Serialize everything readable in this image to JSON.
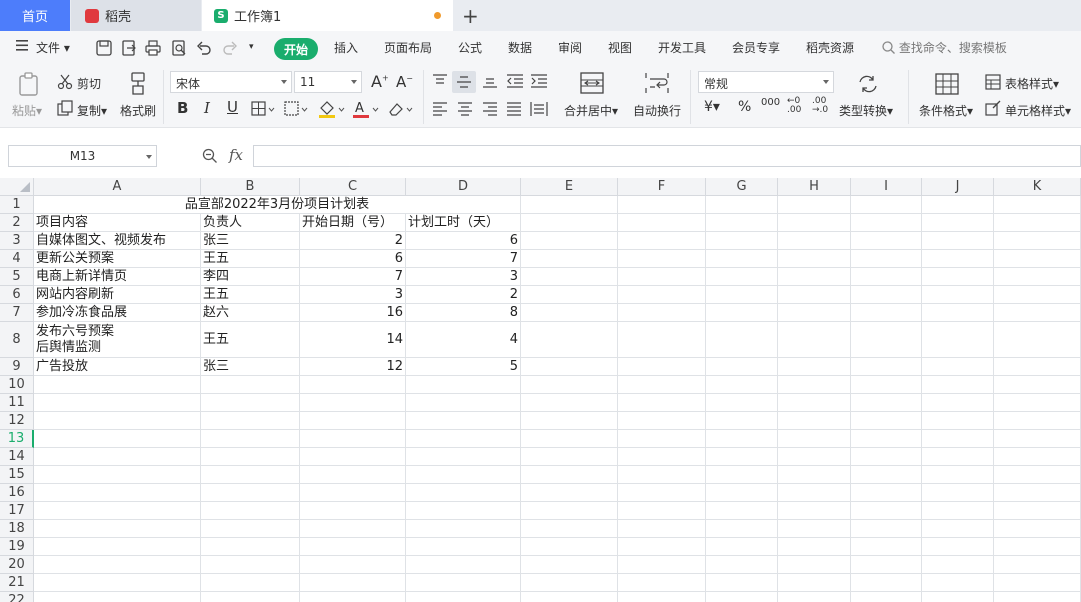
{
  "tabs": {
    "home": "首页",
    "daoke": "稻壳",
    "workbook": "工作簿1"
  },
  "menu": {
    "file": "文件",
    "items": [
      "开始",
      "插入",
      "页面布局",
      "公式",
      "数据",
      "审阅",
      "视图",
      "开发工具",
      "会员专享",
      "稻壳资源"
    ],
    "search_placeholder": "查找命令、搜索模板"
  },
  "ribbon": {
    "paste": "粘贴",
    "cut": "剪切",
    "copy": "复制",
    "format_painter": "格式刷",
    "font_name": "宋体",
    "font_size": "11",
    "merge_center": "合并居中",
    "wrap_text": "自动换行",
    "number_format": "常规",
    "type_convert": "类型转换",
    "cond_format": "条件格式",
    "table_style": "表格样式",
    "cell_style": "单元格样式"
  },
  "formula_bar": {
    "name_box": "M13",
    "fx": "fx",
    "content": ""
  },
  "sheet": {
    "columns": [
      "A",
      "B",
      "C",
      "D",
      "E",
      "F",
      "G",
      "H",
      "I",
      "J",
      "K"
    ],
    "rows": [
      "1",
      "2",
      "3",
      "4",
      "5",
      "6",
      "7",
      "8",
      "9",
      "10",
      "11",
      "12",
      "13",
      "14",
      "15",
      "16",
      "17",
      "18",
      "19",
      "20",
      "21",
      "22"
    ],
    "title": "品宣部2022年3月份项目计划表",
    "headers": [
      "项目内容",
      "负责人",
      "开始日期（号）",
      "计划工时（天）"
    ],
    "data": [
      [
        "自媒体图文、视频发布",
        "张三",
        "2",
        "6"
      ],
      [
        "更新公关预案",
        "王五",
        "6",
        "7"
      ],
      [
        "电商上新详情页",
        "李四",
        "7",
        "3"
      ],
      [
        "网站内容刷新",
        "王五",
        "3",
        "2"
      ],
      [
        "参加冷冻食品展",
        "赵六",
        "16",
        "8"
      ],
      [
        "发布六号预案\n后舆情监测",
        "王五",
        "14",
        "4"
      ],
      [
        "广告投放",
        "张三",
        "12",
        "5"
      ]
    ],
    "active_row": "13"
  }
}
